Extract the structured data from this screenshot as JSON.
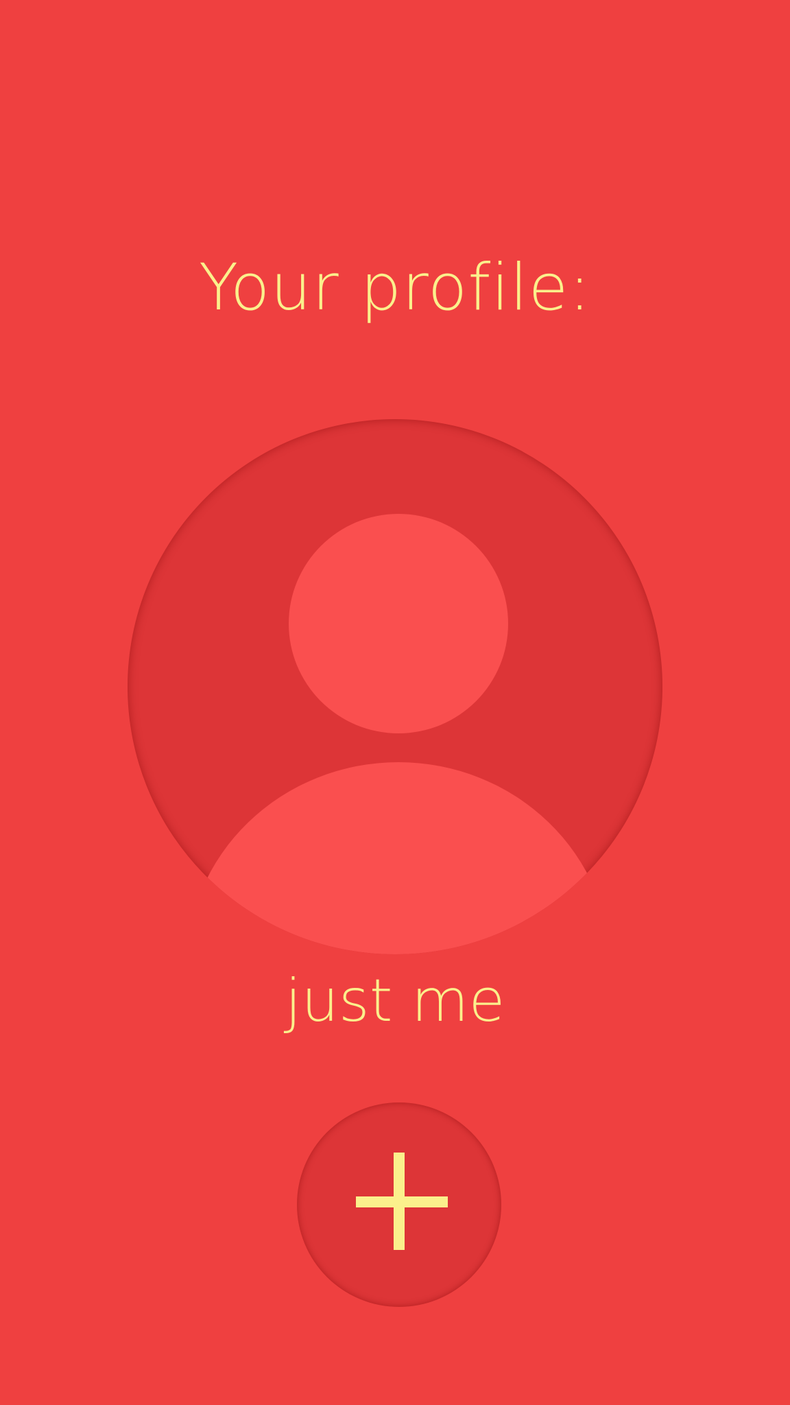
{
  "profile": {
    "title": "Your profile:",
    "name": "just me",
    "avatar_icon": "person-silhouette-icon"
  },
  "actions": {
    "add_icon": "plus-icon"
  },
  "colors": {
    "background": "#ef4040",
    "circle": "#dd3537",
    "silhouette": "#fa4f4f",
    "text": "#fbf08c"
  }
}
